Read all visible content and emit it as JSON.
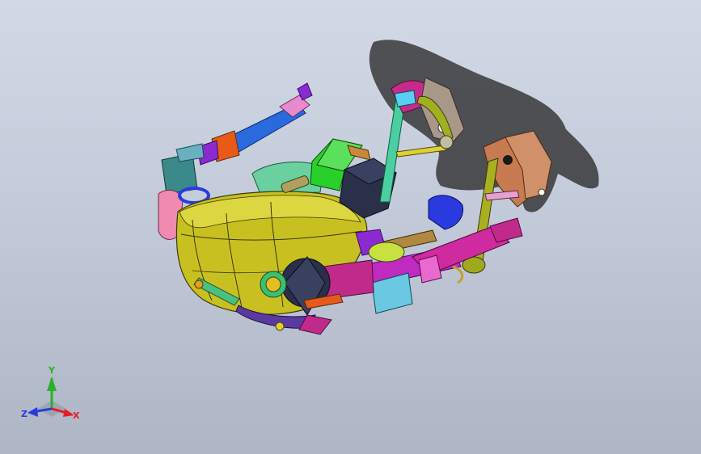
{
  "viewport": {
    "background_top": "#d2d9e6",
    "background_bottom": "#aeb5c4",
    "model": "robot-assembly"
  },
  "triad": {
    "y_label": "Y",
    "x_label": "X",
    "z_label": "Z",
    "colors": {
      "x": "#e0202a",
      "y": "#2ab02a",
      "z": "#2a3adf"
    }
  }
}
